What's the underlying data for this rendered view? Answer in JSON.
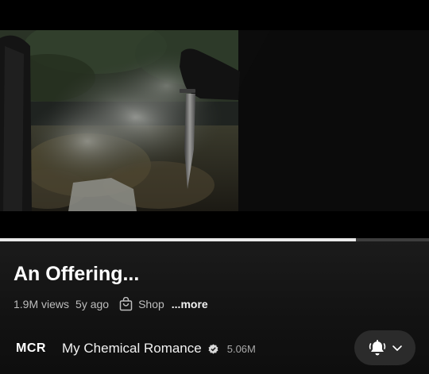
{
  "video": {
    "progress_fraction": 0.83
  },
  "title": "An Offering...",
  "meta": {
    "views": "1.9M views",
    "age": "5y ago",
    "shop_label": "Shop",
    "more_label": "...more"
  },
  "channel": {
    "logo_text": "MCR",
    "name": "My Chemical Romance",
    "verified": true,
    "subscribers": "5.06M"
  },
  "subscribe_button": {
    "icons": [
      "bell-ringing-icon",
      "chevron-down-icon"
    ]
  },
  "colors": {
    "background": "#0f0f0f",
    "progress_fill": "#e9e9e9",
    "progress_track": "#3d3d3d",
    "button_bg": "#2b2b2b"
  }
}
